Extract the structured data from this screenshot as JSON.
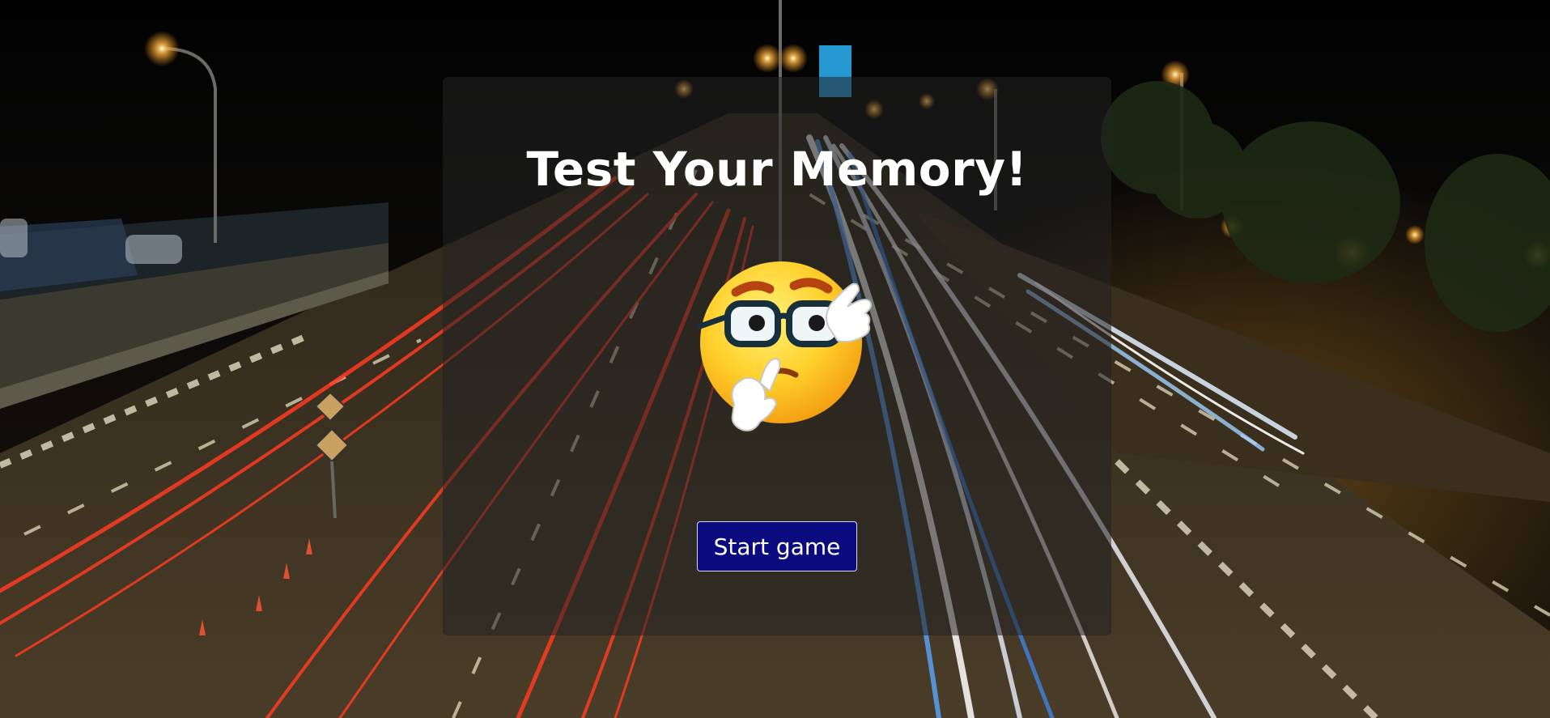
{
  "page": {
    "title": "Test Your Memory!",
    "start_button_label": "Start game"
  },
  "icons": {
    "hero": "thinking-face-with-glasses-emoji"
  },
  "colors": {
    "button_background": "#0b0a7e",
    "button_text": "#ffffff",
    "title_text": "#ffffff",
    "card_overlay": "#232323"
  }
}
